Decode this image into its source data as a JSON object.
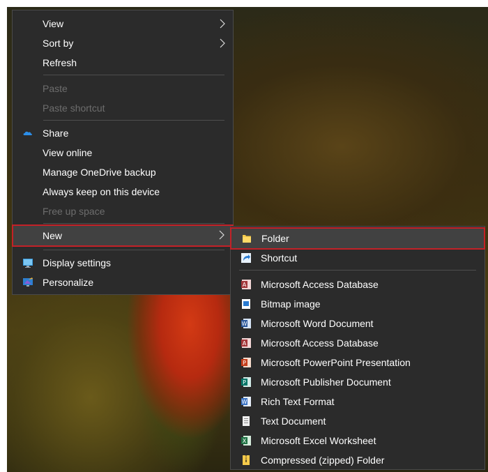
{
  "main_menu": {
    "view": "View",
    "sort_by": "Sort by",
    "refresh": "Refresh",
    "paste": "Paste",
    "paste_shortcut": "Paste shortcut",
    "share": "Share",
    "view_online": "View online",
    "manage_backup": "Manage OneDrive backup",
    "always_keep": "Always keep on this device",
    "free_up_space": "Free up space",
    "new": "New",
    "display_settings": "Display settings",
    "personalize": "Personalize"
  },
  "new_submenu": {
    "folder": "Folder",
    "shortcut": "Shortcut",
    "items": [
      {
        "label": "Microsoft Access Database",
        "icon": "access-icon"
      },
      {
        "label": "Bitmap image",
        "icon": "bitmap-icon"
      },
      {
        "label": "Microsoft Word Document",
        "icon": "word-icon"
      },
      {
        "label": "Microsoft Access Database",
        "icon": "access-icon"
      },
      {
        "label": "Microsoft PowerPoint Presentation",
        "icon": "powerpoint-icon"
      },
      {
        "label": "Microsoft Publisher Document",
        "icon": "publisher-icon"
      },
      {
        "label": "Rich Text Format",
        "icon": "rtf-icon"
      },
      {
        "label": "Text Document",
        "icon": "text-document-icon"
      },
      {
        "label": "Microsoft Excel Worksheet",
        "icon": "excel-icon"
      },
      {
        "label": "Compressed (zipped) Folder",
        "icon": "zip-folder-icon"
      }
    ]
  },
  "colors": {
    "menu_bg": "#2b2b2b",
    "highlight_border": "#c42127",
    "disabled_text": "#6d6d6d"
  }
}
